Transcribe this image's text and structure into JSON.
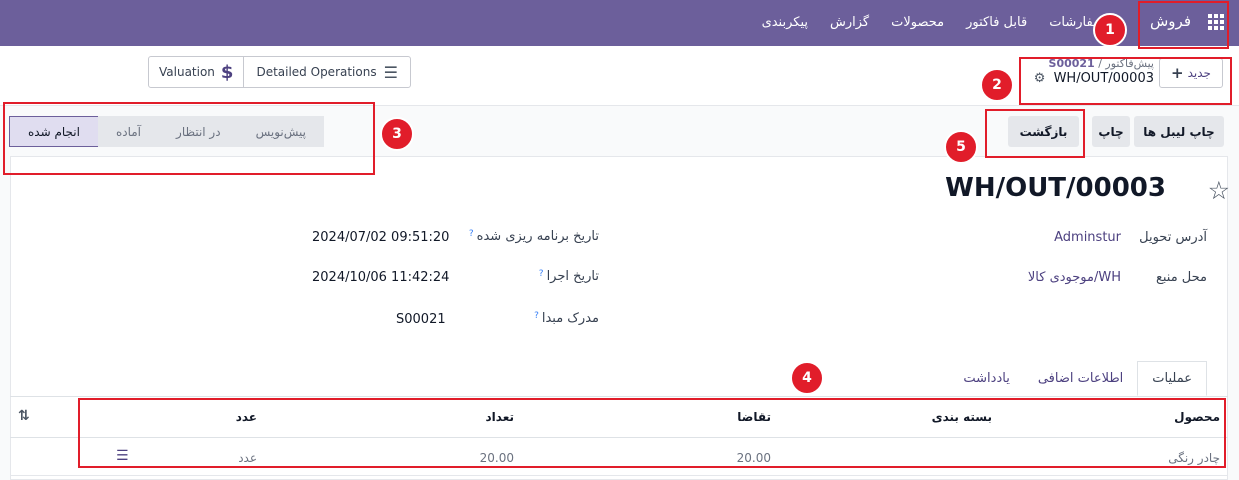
{
  "topbar": {
    "app": "فروش",
    "menu": [
      "پیکربندی",
      "گزارش",
      "محصولات",
      "قابل فاکتور",
      "سفارشات"
    ]
  },
  "control": {
    "new_label": "جدید",
    "breadcrumb_root": "پیش‌فاکتور",
    "breadcrumb_ref": "S00021",
    "subtitle": "WH/OUT/00003",
    "detailed_operations": "Detailed Operations",
    "valuation": "Valuation"
  },
  "actions": {
    "print_labels": "چاپ لیبل ها",
    "print": "چاپ",
    "return": "بازگشت"
  },
  "pipeline": [
    "پیش‌نویس",
    "در انتظار",
    "آماده",
    "انجام شده"
  ],
  "record": {
    "title": "WH/OUT/00003",
    "delivery_address_label": "آدرس تحویل",
    "delivery_address_value": "Adminstur",
    "source_location_label": "محل منبع",
    "source_location_value": "WH/موجودی کالا",
    "scheduled_date_label": "تاریخ برنامه ریزی شده",
    "scheduled_date_value": "2024/07/02 09:51:20",
    "effective_date_label": "تاریخ اجرا",
    "effective_date_value": "2024/10/06 11:42:24",
    "source_document_label": "مدرک مبدا",
    "source_document_value": "S00021",
    "help": "?"
  },
  "tabs": [
    "عملیات",
    "اطلاعات اضافی",
    "یادداشت"
  ],
  "table": {
    "headers": {
      "product": "محصول",
      "packaging": "بسته بندی",
      "demand": "تقاضا",
      "quantity": "تعداد",
      "uom": "عدد"
    },
    "rows": [
      {
        "product": "چادر رنگی",
        "demand": "20.00",
        "quantity": "20.00",
        "uom": "عدد"
      }
    ]
  },
  "annotations": [
    "1",
    "2",
    "3",
    "4",
    "5"
  ],
  "colors": {
    "primary": "#6c5f9b",
    "highlight": "#e11d2a"
  }
}
